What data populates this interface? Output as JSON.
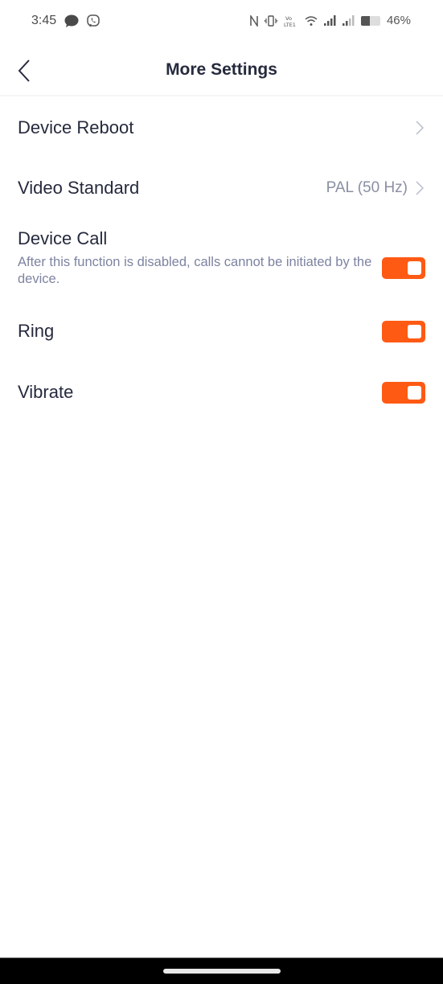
{
  "status_bar": {
    "time": "3:45",
    "left_icons": [
      "chat-bubble-icon",
      "viber-icon"
    ],
    "right_icons": [
      "nfc-icon",
      "vibrate-icon",
      "volte-lte1-icon",
      "wifi-icon",
      "signal-sim1-icon",
      "signal-sim2-icon",
      "battery-icon"
    ],
    "battery_percent_label": "46%",
    "battery_level": 0.46,
    "volte_label": "Vo))",
    "lte_label": "LTE1"
  },
  "header": {
    "title": "More Settings",
    "back_icon": "chevron-left-icon"
  },
  "settings": {
    "device_reboot": {
      "label": "Device Reboot"
    },
    "video_standard": {
      "label": "Video Standard",
      "value": "PAL (50 Hz)"
    },
    "device_call": {
      "label": "Device Call",
      "description": "After this function is disabled, calls cannot be initiated by the device.",
      "enabled": true
    },
    "ring": {
      "label": "Ring",
      "enabled": true
    },
    "vibrate": {
      "label": "Vibrate",
      "enabled": true
    }
  },
  "colors": {
    "accent": "#ff5a14",
    "title_text": "#262a3d",
    "secondary_text": "#7d83a1",
    "value_text": "#8a8fa3"
  }
}
